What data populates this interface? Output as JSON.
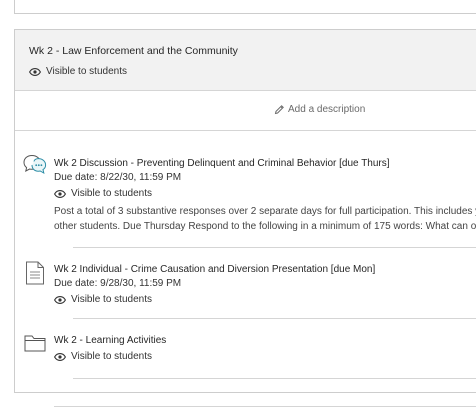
{
  "folder": {
    "title": "Wk 2 - Law Enforcement and the Community",
    "visibility": "Visible to students",
    "add_description": "Add a description"
  },
  "items": [
    {
      "type": "discussion",
      "icon": "discussion-icon",
      "title": "Wk 2 Discussion - Preventing Delinquent and Criminal Behavior [due Thurs]",
      "due": "Due date: 8/22/30, 11:59 PM",
      "visibility": "Visible to students",
      "description_line1": "Post a total of 3 substantive responses over 2 separate days for full participation. This includes yo",
      "description_line2": "other students. Due Thursday Respond to the following in a minimum of 175 words:  What can of"
    },
    {
      "type": "assignment",
      "icon": "document-icon",
      "title": "Wk 2 Individual - Crime Causation and Diversion Presentation [due Mon]",
      "due": "Due date: 9/28/30, 11:59 PM",
      "visibility": "Visible to students"
    },
    {
      "type": "folder",
      "icon": "folder-icon",
      "title": "Wk 2 - Learning Activities",
      "visibility": "Visible to students"
    }
  ]
}
